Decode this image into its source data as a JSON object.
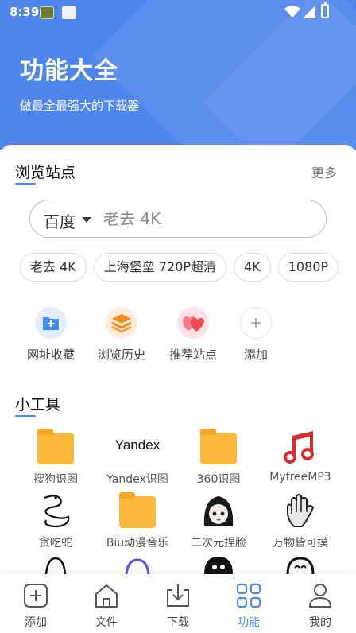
{
  "status_bar": {
    "time": "8:39"
  },
  "header": {
    "title": "功能大全",
    "subtitle": "做最全最强大的下载器",
    "background": "#4f86ec"
  },
  "browse": {
    "title": "浏览站点",
    "more_label": "更多",
    "search": {
      "engine": "百度",
      "placeholder": "老去 4K"
    },
    "chips": [
      "老去 4K",
      "上海堡垒 720P超清",
      "4K",
      "1080P"
    ],
    "quick_actions": [
      {
        "label": "网址收藏",
        "icon": "bookmark-folder-icon",
        "color": "#3f8ef0"
      },
      {
        "label": "浏览历史",
        "icon": "history-stack-icon",
        "color": "#f28a1e"
      },
      {
        "label": "推荐站点",
        "icon": "hearts-icon",
        "color": "#ee4a56"
      },
      {
        "label": "添加",
        "icon": "plus-icon",
        "color": "#999999"
      }
    ]
  },
  "tools": {
    "title": "小工具",
    "items": [
      {
        "label": "搜狗识图",
        "icon": "folder-icon"
      },
      {
        "label": "Yandex识图",
        "icon": "yandex-logo-icon",
        "logo_text": "Yandex"
      },
      {
        "label": "360识图",
        "icon": "folder-icon"
      },
      {
        "label": "MyfreeMP3",
        "icon": "music-note-icon"
      },
      {
        "label": "贪吃蛇",
        "icon": "snake-icon"
      },
      {
        "label": "Biu动漫音乐",
        "icon": "folder-icon"
      },
      {
        "label": "二次元捏脸",
        "icon": "anime-face-icon"
      },
      {
        "label": "万物皆可摸",
        "icon": "hand-icon"
      }
    ]
  },
  "bottom_nav": {
    "items": [
      {
        "label": "添加",
        "icon": "add-box-icon"
      },
      {
        "label": "文件",
        "icon": "home-file-icon"
      },
      {
        "label": "下载",
        "icon": "download-tray-icon"
      },
      {
        "label": "功能",
        "icon": "grid-apps-icon",
        "active": true
      },
      {
        "label": "我的",
        "icon": "person-icon"
      }
    ],
    "active_color": "#4f86ec"
  }
}
